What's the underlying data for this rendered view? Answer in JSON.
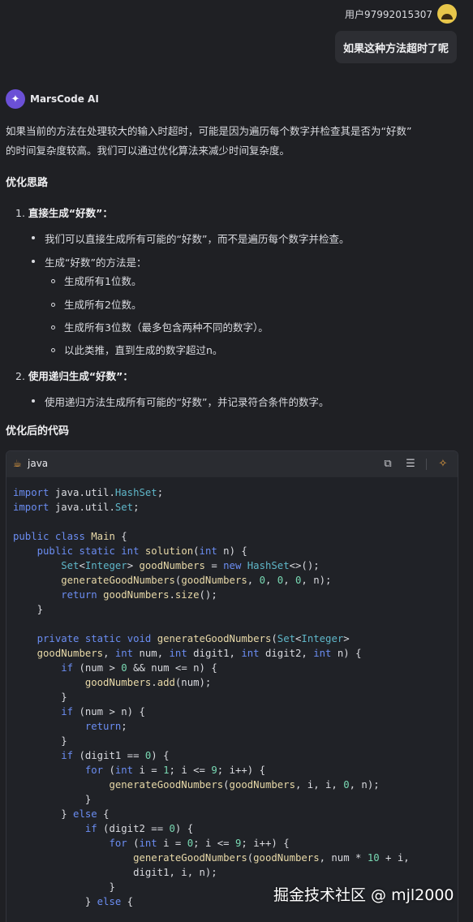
{
  "user": {
    "name": "用户979920​15307",
    "question": "如果这种方法超时了呢"
  },
  "ai": {
    "name": "MarsCode AI",
    "intro_line1": "如果当前的方法在处理较大的输入时超时，可能是因为遍历每个数字并检查其是否为“好数”",
    "intro_line2": "的时间复杂度较高。我们可以通过优化算法来减少时间复杂度。"
  },
  "sections": {
    "ideas_heading": "优化思路",
    "item1_number": "1.",
    "item1_title": "直接生成“好数”：",
    "item1_bullet1": "我们可以直接生成所有可能的“好数”，而不是遍历每个数字并检查。",
    "item1_bullet2": "生成“好数”的方法是：",
    "sub1": "生成所有1位数。",
    "sub2": "生成所有2位数。",
    "sub3": "生成所有3位数（最多包含两种不同的数字）。",
    "sub4": "以此类推，直到生成的数字超过n。",
    "item2_number": "2.",
    "item2_title": "使用递归生成“好数”：",
    "item2_bullet1": "使用递归方法生成所有可能的“好数”，并记录符合条件的数字。",
    "code_heading": "优化后的代码"
  },
  "code_block": {
    "language": "java",
    "icons": [
      "coffee-icon",
      "copy-icon",
      "insert-icon",
      "lightbulb-icon"
    ],
    "lines": [
      "import java.util.HashSet;",
      "import java.util.Set;",
      "",
      "public class Main {",
      "    public static int solution(int n) {",
      "        Set<Integer> goodNumbers = new HashSet<>();",
      "        generateGoodNumbers(goodNumbers, 0, 0, 0, n);",
      "        return goodNumbers.size();",
      "    }",
      "",
      "    private static void generateGoodNumbers(Set<Integer>",
      "    goodNumbers, int num, int digit1, int digit2, int n) {",
      "        if (num > 0 && num <= n) {",
      "            goodNumbers.add(num);",
      "        }",
      "        if (num > n) {",
      "            return;",
      "        }",
      "        if (digit1 == 0) {",
      "            for (int i = 1; i <= 9; i++) {",
      "                generateGoodNumbers(goodNumbers, i, i, 0, n);",
      "            }",
      "        } else {",
      "            if (digit2 == 0) {",
      "                for (int i = 0; i <= 9; i++) {",
      "                    generateGoodNumbers(goodNumbers, num * 10 + i,",
      "                    digit1, i, n);",
      "                }",
      "            } else {"
    ]
  },
  "watermark": "掘金技术社区 @ mjl2000"
}
